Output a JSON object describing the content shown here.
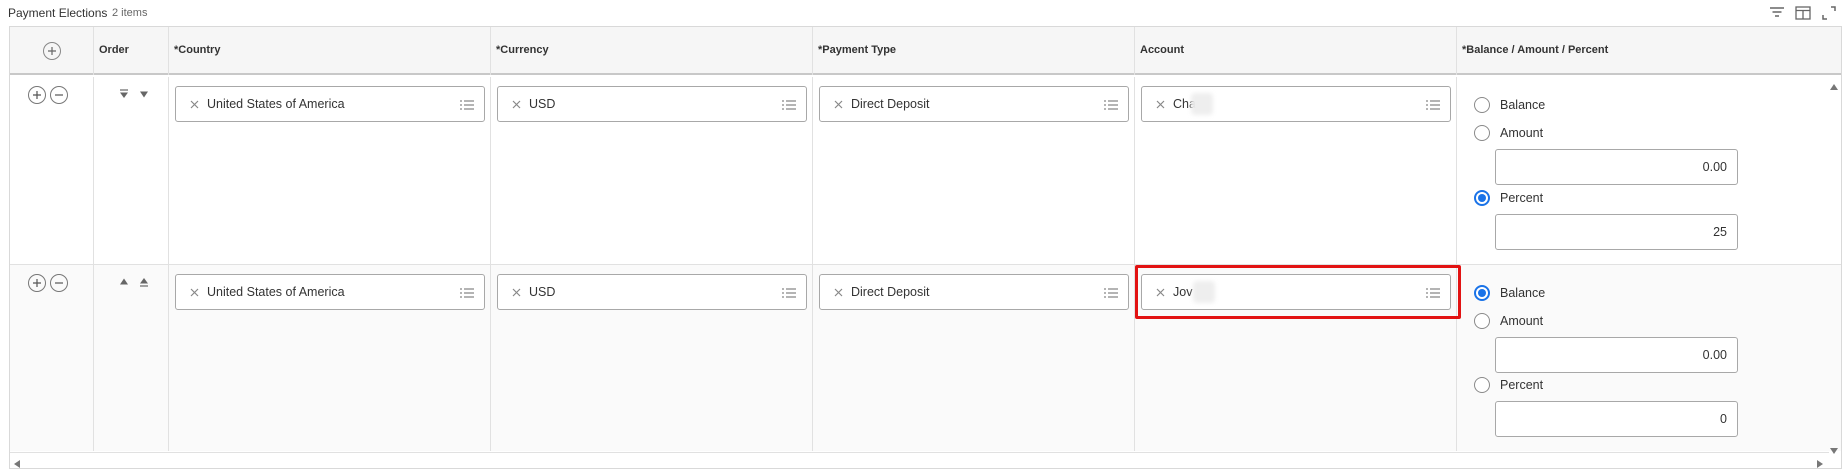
{
  "header": {
    "title": "Payment Elections",
    "count": "2 items"
  },
  "header_icons": [
    "filter-icon",
    "column-chooser-icon",
    "fullscreen-icon"
  ],
  "columns": [
    "Order",
    "*Country",
    "*Currency",
    "*Payment Type",
    "Account",
    "*Balance / Amount / Percent"
  ],
  "rows": [
    {
      "country": "United States of America",
      "currency": "USD",
      "payment_type": "Direct Deposit",
      "account": "Cha",
      "options": {
        "balance": "Balance",
        "amount": "Amount",
        "percent": "Percent"
      },
      "amount_value": "0.00",
      "percent_value": "25",
      "selected": "percent"
    },
    {
      "country": "United States of America",
      "currency": "USD",
      "payment_type": "Direct Deposit",
      "account": "Jov",
      "options": {
        "balance": "Balance",
        "amount": "Amount",
        "percent": "Percent"
      },
      "amount_value": "0.00",
      "percent_value": "0",
      "selected": "balance"
    }
  ],
  "colors": {
    "accent": "#1a73e8",
    "highlight": "#e21212",
    "border": "#a8a8a8"
  }
}
